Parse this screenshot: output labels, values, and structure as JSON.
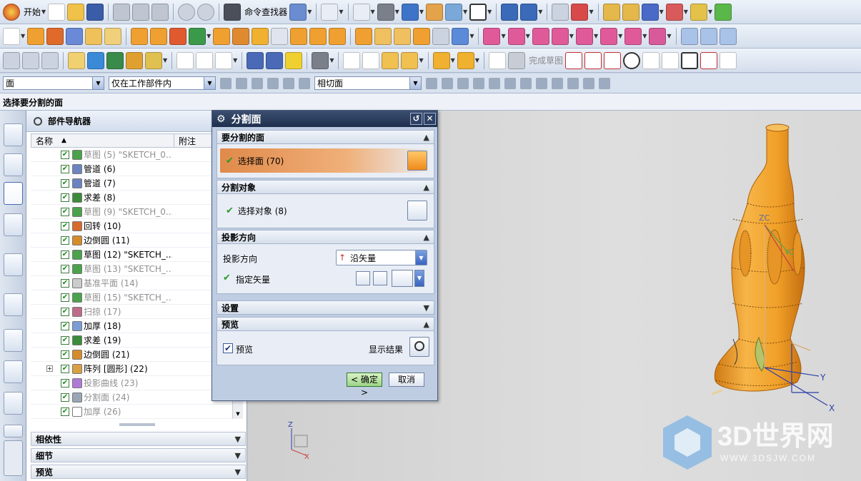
{
  "toolbar": {
    "start_label": "开始",
    "cmd_finder_label": "命令查找器",
    "finish_sketch_label": "完成草图"
  },
  "selection_bar": {
    "filter_value": "面",
    "scope_value": "仅在工作部件内",
    "snap_value": "相切面"
  },
  "prompt": "选择要分割的面",
  "navigator": {
    "title": "部件导航器",
    "col_name": "名称",
    "col_note": "附注",
    "rows": [
      {
        "label": "草图 (5) \"SKETCH_0...",
        "dim": true,
        "color": "#4aa24a"
      },
      {
        "label": "管道 (6)",
        "dim": false,
        "color": "#6b83c2"
      },
      {
        "label": "管道 (7)",
        "dim": false,
        "color": "#6b83c2"
      },
      {
        "label": "求差 (8)",
        "dim": false,
        "color": "#3a8c3a"
      },
      {
        "label": "草图 (9) \"SKETCH_0...",
        "dim": true,
        "color": "#4aa24a"
      },
      {
        "label": "回转 (10)",
        "dim": false,
        "color": "#d86a2a"
      },
      {
        "label": "边倒圆 (11)",
        "dim": false,
        "color": "#d68b2a"
      },
      {
        "label": "草图 (12) \"SKETCH_...",
        "dim": false,
        "color": "#4aa24a"
      },
      {
        "label": "草图 (13) \"SKETCH_...",
        "dim": true,
        "color": "#4aa24a"
      },
      {
        "label": "基准平面 (14)",
        "dim": true,
        "color": "#cccccc"
      },
      {
        "label": "草图 (15) \"SKETCH_...",
        "dim": true,
        "color": "#4aa24a"
      },
      {
        "label": "扫掠 (17)",
        "dim": true,
        "color": "#c06a8a"
      },
      {
        "label": "加厚 (18)",
        "dim": false,
        "color": "#7c9cd6"
      },
      {
        "label": "求差 (19)",
        "dim": false,
        "color": "#3a8c3a"
      },
      {
        "label": "边倒圆 (21)",
        "dim": false,
        "color": "#d68b2a"
      },
      {
        "label": "阵列 [圆形] (22)",
        "dim": false,
        "color": "#d8a040",
        "expand": true
      },
      {
        "label": "投影曲线 (23)",
        "dim": true,
        "color": "#b07ad8"
      },
      {
        "label": "分割面 (24)",
        "dim": true,
        "color": "#9aa6b8"
      },
      {
        "label": "加厚 (26)",
        "dim": true,
        "color": "#ffffff"
      }
    ],
    "panels": [
      "相依性",
      "细节",
      "预览"
    ]
  },
  "dialog": {
    "title": "分割面",
    "sec_faces": "要分割的面",
    "select_face": "选择面 (70)",
    "sec_objects": "分割对象",
    "select_object": "选择对象 (8)",
    "sec_direction": "投影方向",
    "direction_label": "投影方向",
    "direction_value": "沿矢量",
    "vector_label": "指定矢量",
    "sec_settings": "设置",
    "sec_preview": "预览",
    "preview_label": "预览",
    "show_result_label": "显示结果",
    "ok_label": "< 确定 >",
    "cancel_label": "取消"
  },
  "viewport": {
    "axis_zc": "ZC",
    "axis_yc": "YC",
    "axis_y": "Y",
    "axis_x": "X",
    "axis_z": "Z",
    "watermark_main": "3D世界网",
    "watermark_sub": "WWW.3DSJW.COM"
  },
  "colors": {
    "accent_orange": "#f5a52a",
    "titlebar": "#26365a",
    "select_gradient_start": "#e4924e"
  }
}
